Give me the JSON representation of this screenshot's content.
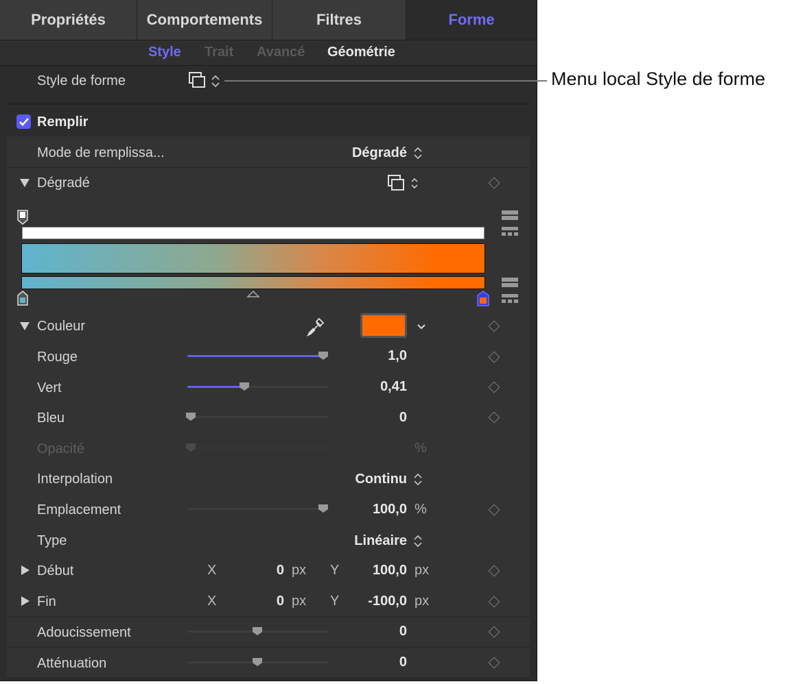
{
  "tabs": [
    "Propriétés",
    "Comportements",
    "Filtres",
    "Forme"
  ],
  "subtabs": [
    "Style",
    "Trait",
    "Avancé",
    "Géométrie"
  ],
  "shape_style": {
    "label": "Style de forme"
  },
  "annotation": "Menu local Style de forme",
  "fill": {
    "label": "Remplir",
    "checked": true
  },
  "fill_mode": {
    "label": "Mode de remplissa...",
    "value": "Dégradé"
  },
  "gradient": {
    "label": "Dégradé",
    "start_color": "#5fb4cf",
    "end_color": "#ff6b00"
  },
  "color": {
    "label": "Couleur",
    "swatch": "#ff6b00"
  },
  "params": {
    "red": {
      "label": "Rouge",
      "value": "1,0",
      "level": 1.0
    },
    "green": {
      "label": "Vert",
      "value": "0,41",
      "level": 0.41
    },
    "blue": {
      "label": "Bleu",
      "value": "0",
      "level": 0
    },
    "opacity": {
      "label": "Opacité",
      "unit": "%"
    },
    "interpolation": {
      "label": "Interpolation",
      "value": "Continu"
    },
    "location": {
      "label": "Emplacement",
      "value": "100,0",
      "unit": "%"
    },
    "type": {
      "label": "Type",
      "value": "Linéaire"
    },
    "start": {
      "label": "Début",
      "x_label": "X",
      "x": "0",
      "x_unit": "px",
      "y_label": "Y",
      "y": "100,0",
      "y_unit": "px"
    },
    "end": {
      "label": "Fin",
      "x_label": "X",
      "x": "0",
      "x_unit": "px",
      "y_label": "Y",
      "y": "-100,0",
      "y_unit": "px"
    },
    "softness": {
      "label": "Adoucissement",
      "value": "0"
    },
    "attenuation": {
      "label": "Atténuation",
      "value": "0"
    }
  }
}
